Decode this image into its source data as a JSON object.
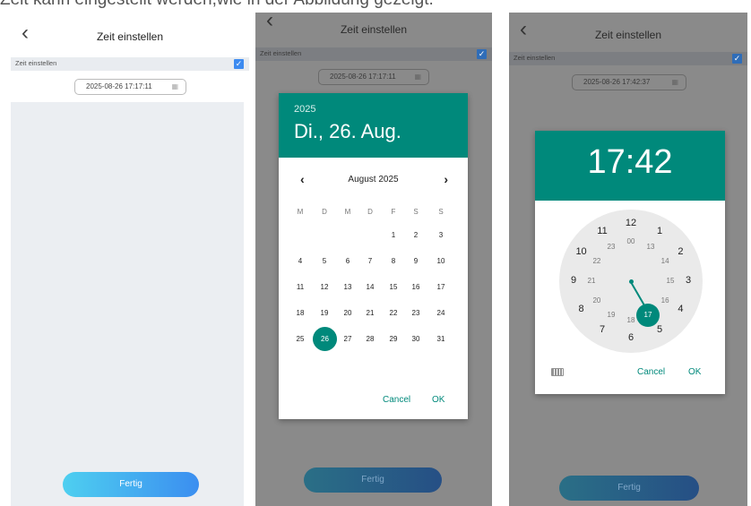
{
  "caption": "Zeit kann eingestellt werden,wie in der Abbildung gezeigt.",
  "screen1": {
    "back_icon": "‹",
    "title": "Zeit einstellen",
    "row_label": "Zeit einstellen",
    "datetime_value": "2025-08-26 17:17:11",
    "done_button": "Fertig"
  },
  "screen2": {
    "back_icon": "‹",
    "title": "Zeit einstellen",
    "row_label": "Zeit einstellen",
    "datetime_value": "2025-08-26 17:17:11",
    "done_button": "Fertig",
    "dialog": {
      "year": "2025",
      "date": "Di., 26. Aug.",
      "month_label": "August 2025",
      "prev": "‹",
      "next": "›",
      "weekdays": [
        "M",
        "D",
        "M",
        "D",
        "F",
        "S",
        "S"
      ],
      "weeks": [
        [
          "",
          "",
          "",
          "",
          "1",
          "2",
          "3"
        ],
        [
          "4",
          "5",
          "6",
          "7",
          "8",
          "9",
          "10"
        ],
        [
          "11",
          "12",
          "13",
          "14",
          "15",
          "16",
          "17"
        ],
        [
          "18",
          "19",
          "20",
          "21",
          "22",
          "23",
          "24"
        ],
        [
          "25",
          "26",
          "27",
          "28",
          "29",
          "30",
          "31"
        ]
      ],
      "selected_day": "26",
      "cancel": "Cancel",
      "ok": "OK"
    }
  },
  "screen3": {
    "back_icon": "‹",
    "title": "Zeit einstellen",
    "row_label": "Zeit einstellen",
    "datetime_value": "2025-08-26 17:42:37",
    "done_button": "Fertig",
    "dialog": {
      "time": "17:42",
      "outer_hours": [
        "12",
        "1",
        "2",
        "3",
        "4",
        "5",
        "6",
        "7",
        "8",
        "9",
        "10",
        "11"
      ],
      "inner_hours": [
        "00",
        "13",
        "14",
        "15",
        "16",
        "17",
        "18",
        "19",
        "20",
        "21",
        "22",
        "23"
      ],
      "selected_hour": "17",
      "cancel": "Cancel",
      "ok": "OK"
    }
  },
  "colors": {
    "teal": "#00897b",
    "blue_check": "#3d8bf0",
    "grey_bg": "#ebeef2"
  },
  "icons": [
    "back-chevron-icon",
    "checkbox-checked-icon",
    "calendar-icon",
    "keyboard-icon"
  ]
}
